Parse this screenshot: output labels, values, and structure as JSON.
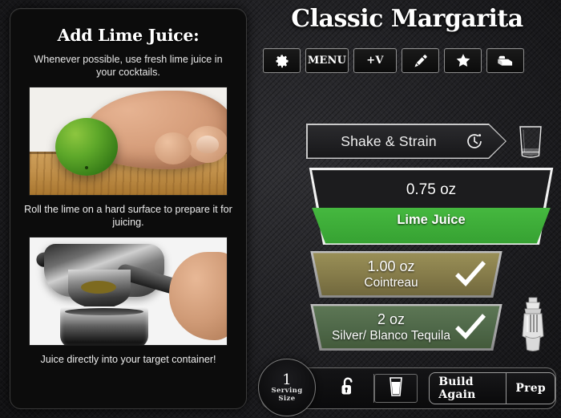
{
  "left_panel": {
    "title": "Add Lime Juice:",
    "subtitle": "Whenever possible, use fresh lime juice in your cocktails.",
    "caption_1": "Roll the lime on a hard surface to prepare it for juicing.",
    "caption_2": "Juice directly into your target container!",
    "photo_1_alt": "hand rolling a lime on a wooden cutting board",
    "photo_2_alt": "metal citrus press squeezing juice into a metal cup"
  },
  "header": {
    "recipe_title": "Classic Margarita"
  },
  "toolbar": {
    "buttons": [
      {
        "name": "settings",
        "icon": "gear-icon",
        "label": ""
      },
      {
        "name": "menu",
        "icon": "",
        "label": "MENU"
      },
      {
        "name": "add-volume",
        "icon": "",
        "label": "+V"
      },
      {
        "name": "edit",
        "icon": "marker-icon",
        "label": ""
      },
      {
        "name": "favorite",
        "icon": "star-icon",
        "label": ""
      },
      {
        "name": "recipe-box",
        "icon": "recipe-box-icon",
        "label": ""
      }
    ]
  },
  "method": {
    "label": "Shake & Strain",
    "timer_icon": "timer-icon",
    "glass_icon": "rocks-glass-icon"
  },
  "ingredients": [
    {
      "amount": "0.75 oz",
      "name": "Lime Juice",
      "state": "active",
      "color": "#3CAF3C"
    },
    {
      "amount": "1.00 oz",
      "name": "Cointreau",
      "state": "complete",
      "color": "#847A49"
    },
    {
      "amount": "2 oz",
      "name": "Silver/ Blanco Tequila",
      "state": "complete",
      "color": "#4E6748"
    }
  ],
  "shaker_icon": "cocktail-shaker-icon",
  "bottom_bar": {
    "serving_count": "1",
    "serving_label_line1": "Serving",
    "serving_label_line2": "Size",
    "lock_icon": "unlocked-padlock-icon",
    "glass_icon": "pint-glass-icon",
    "build_again_label": "Build Again",
    "prep_label": "Prep"
  },
  "colors": {
    "background": "#232326",
    "panel": "#0C0C0C",
    "accent_green": "#3CAF3C",
    "gold": "#847A49",
    "olive_green": "#4E6748",
    "text": "#FFFFFF"
  }
}
